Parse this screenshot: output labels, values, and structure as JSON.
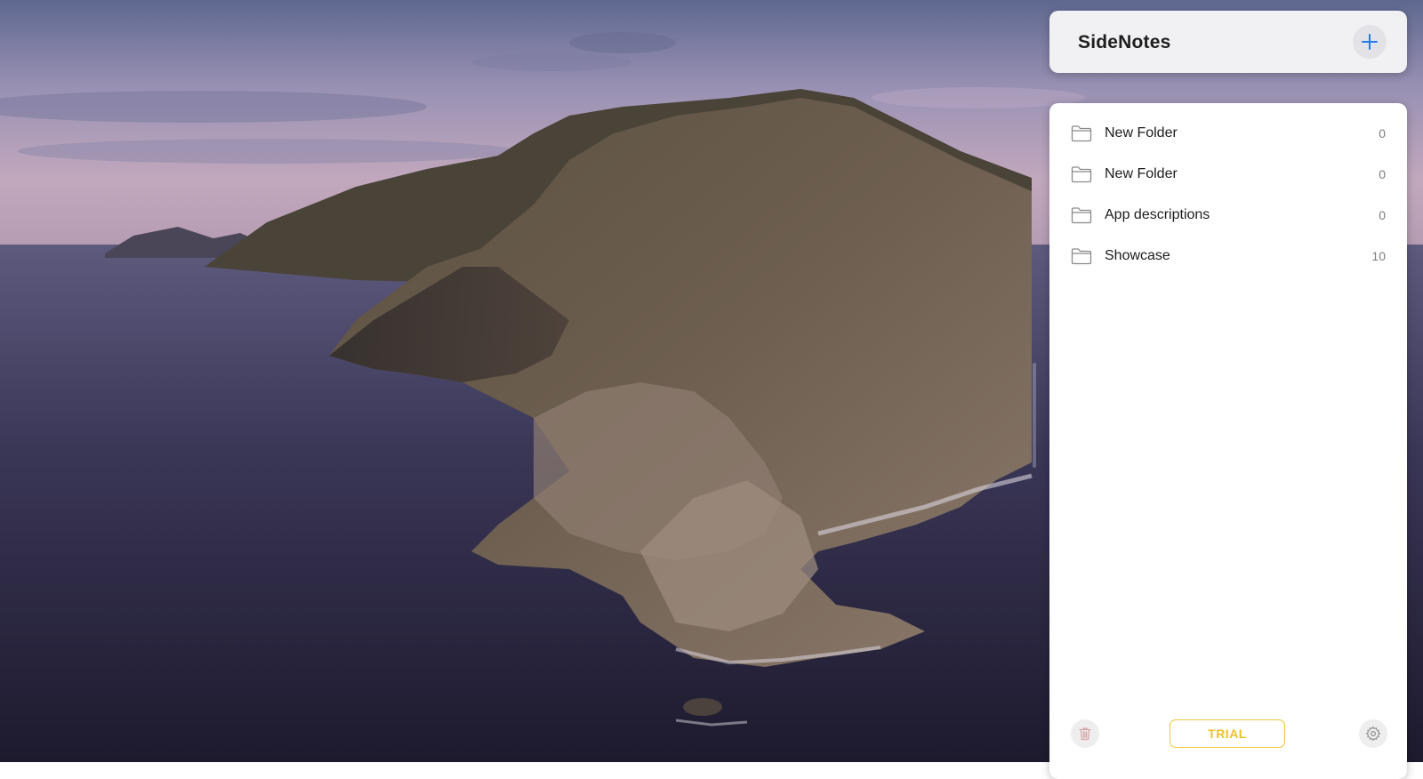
{
  "app": {
    "title": "SideNotes"
  },
  "folders": [
    {
      "name": "New Folder",
      "count": "0"
    },
    {
      "name": "New Folder",
      "count": "0"
    },
    {
      "name": "App descriptions",
      "count": "0"
    },
    {
      "name": "Showcase",
      "count": "10"
    }
  ],
  "footer": {
    "trial_label": "TRIAL"
  },
  "icons": {
    "add": "plus-icon",
    "folder": "folder-icon",
    "trash": "trash-icon",
    "settings": "gear-icon"
  },
  "colors": {
    "accent": "#1e7cf2",
    "trial": "#eec12f",
    "panel_background": "#ffffff",
    "header_background": "#f1f0f2"
  }
}
